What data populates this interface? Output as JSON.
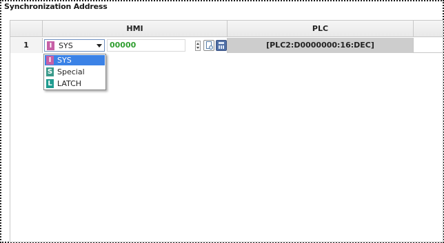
{
  "panel": {
    "title": "Synchronization Address"
  },
  "table": {
    "columns": [
      "",
      "HMI",
      "PLC"
    ],
    "rows": [
      {
        "index": "1",
        "hmi": {
          "device_badge": "I",
          "device": "SYS",
          "address": "00000"
        },
        "plc": "[PLC2:D0000000:16:DEC]"
      }
    ]
  },
  "device_dropdown": {
    "selected": "SYS",
    "options": [
      {
        "badge": "I",
        "label": "SYS",
        "color": "#c65fa6"
      },
      {
        "badge": "S",
        "label": "Special",
        "color": "#3a9a8a"
      },
      {
        "badge": "L",
        "label": "LATCH",
        "color": "#1f9b8f"
      }
    ]
  },
  "icons": {
    "spinner": "spin-updown-icon",
    "tag_browser": "tag-browser-icon",
    "calculator": "calculator-keypad-icon"
  },
  "colors": {
    "address_text": "#2f9e2f",
    "plc_cell_bg": "#cdcdcd",
    "dropdown_selection": "#3b82e6"
  }
}
